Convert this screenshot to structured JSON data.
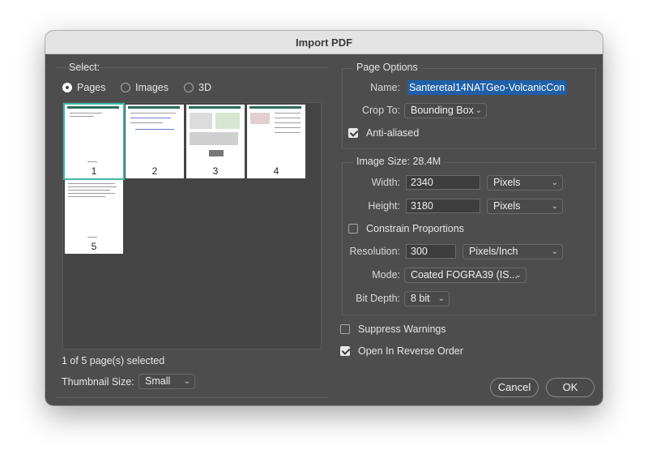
{
  "window": {
    "title": "Import PDF"
  },
  "select_group": {
    "label": "Select:",
    "options": [
      {
        "label": "Pages",
        "selected": true
      },
      {
        "label": "Images",
        "selected": false
      },
      {
        "label": "3D",
        "selected": false
      }
    ],
    "pages": [
      {
        "number": "1",
        "selected": true
      },
      {
        "number": "2",
        "selected": false
      },
      {
        "number": "3",
        "selected": false
      },
      {
        "number": "4",
        "selected": false
      },
      {
        "number": "5",
        "selected": false
      }
    ],
    "status": "1 of 5 page(s) selected",
    "thumbnail_size_label": "Thumbnail Size:",
    "thumbnail_size_value": "Small"
  },
  "page_options": {
    "label": "Page Options",
    "name_label": "Name:",
    "name_value": "Santeretal14NATGeo-VolcanicCon",
    "crop_label": "Crop To:",
    "crop_value": "Bounding Box",
    "anti_aliased_label": "Anti-aliased",
    "anti_aliased": true
  },
  "image_size": {
    "label": "Image Size: 28.4M",
    "width_label": "Width:",
    "width_value": "2340",
    "width_unit": "Pixels",
    "height_label": "Height:",
    "height_value": "3180",
    "height_unit": "Pixels",
    "constrain_label": "Constrain Proportions",
    "constrain": false,
    "resolution_label": "Resolution:",
    "resolution_value": "300",
    "resolution_unit": "Pixels/Inch",
    "mode_label": "Mode:",
    "mode_value": "Coated FOGRA39 (IS...",
    "bit_depth_label": "Bit Depth:",
    "bit_depth_value": "8 bit"
  },
  "options": {
    "suppress_warnings_label": "Suppress Warnings",
    "suppress_warnings": false,
    "reverse_order_label": "Open In Reverse Order",
    "reverse_order": true
  },
  "buttons": {
    "cancel": "Cancel",
    "ok": "OK"
  },
  "colors": {
    "accent": "#3bb7a8",
    "selection": "#1f5fa8",
    "window_bg": "#4d4d4d"
  }
}
